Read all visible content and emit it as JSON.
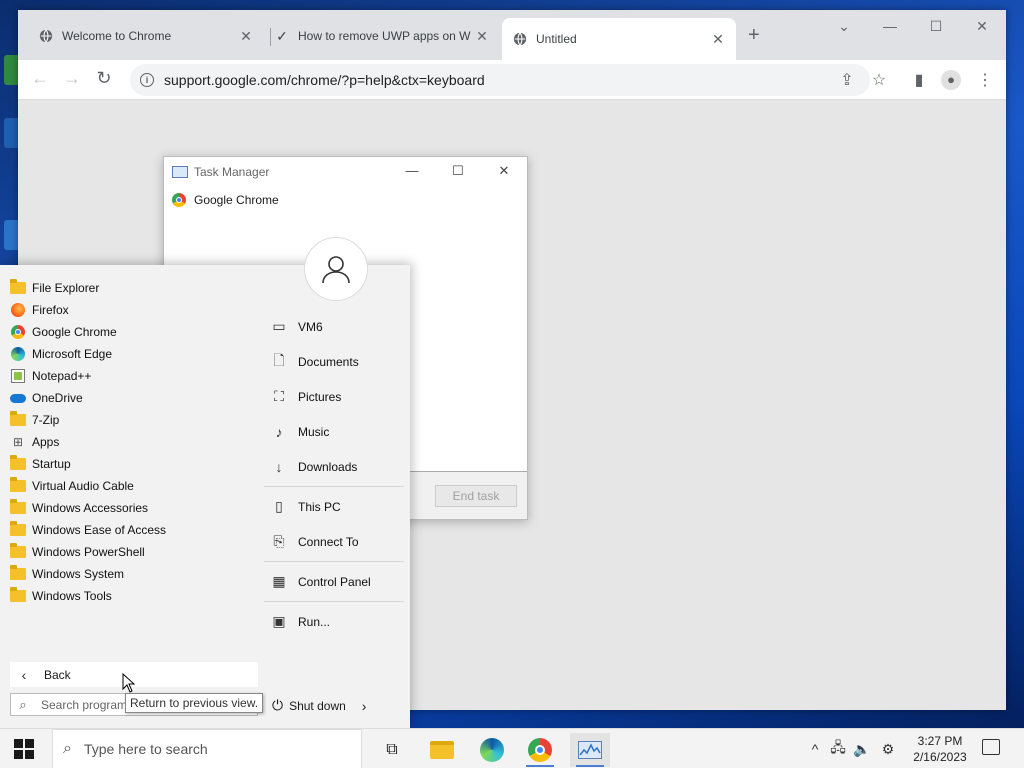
{
  "browser": {
    "tabs": [
      {
        "title": "Welcome to Chrome",
        "active": false
      },
      {
        "title": "How to remove UWP apps on W",
        "active": false
      },
      {
        "title": "Untitled",
        "active": true
      }
    ],
    "new_tab": "+",
    "url": "support.google.com/chrome/?p=help&ctx=keyboard"
  },
  "task_manager": {
    "title": "Task Manager",
    "process": "Google Chrome",
    "end_task": "End task"
  },
  "start_menu": {
    "programs": [
      {
        "label": "File Explorer",
        "icon": "folder-icon"
      },
      {
        "label": "Firefox",
        "icon": "firefox-icon"
      },
      {
        "label": "Google Chrome",
        "icon": "chrome-icon"
      },
      {
        "label": "Microsoft Edge",
        "icon": "edge-icon"
      },
      {
        "label": "Notepad++",
        "icon": "notepadpp-icon"
      },
      {
        "label": "OneDrive",
        "icon": "onedrive-icon"
      },
      {
        "label": "7-Zip",
        "icon": "folder-icon"
      },
      {
        "label": "Apps",
        "icon": "apps-icon"
      },
      {
        "label": "Startup",
        "icon": "folder-icon"
      },
      {
        "label": "Virtual Audio Cable",
        "icon": "folder-icon"
      },
      {
        "label": "Windows Accessories",
        "icon": "folder-icon"
      },
      {
        "label": "Windows Ease of Access",
        "icon": "folder-icon"
      },
      {
        "label": "Windows PowerShell",
        "icon": "folder-icon"
      },
      {
        "label": "Windows System",
        "icon": "folder-icon"
      },
      {
        "label": "Windows Tools",
        "icon": "folder-icon"
      }
    ],
    "places": [
      {
        "label": "VM6",
        "icon": "user-folder-icon"
      },
      {
        "label": "Documents",
        "icon": "document-icon"
      },
      {
        "label": "Pictures",
        "icon": "picture-icon"
      },
      {
        "label": "Music",
        "icon": "music-icon"
      },
      {
        "label": "Downloads",
        "icon": "download-icon"
      },
      {
        "label": "This PC",
        "icon": "computer-icon"
      },
      {
        "label": "Connect To",
        "icon": "connect-icon"
      },
      {
        "label": "Control Panel",
        "icon": "control-panel-icon"
      },
      {
        "label": "Run...",
        "icon": "run-icon"
      }
    ],
    "back_label": "Back",
    "search_placeholder": "Search programs and files",
    "tooltip": "Return to previous view.",
    "shutdown_label": "Shut down"
  },
  "taskbar": {
    "search_placeholder": "Type here to search",
    "time": "3:27 PM",
    "date": "2/16/2023"
  }
}
